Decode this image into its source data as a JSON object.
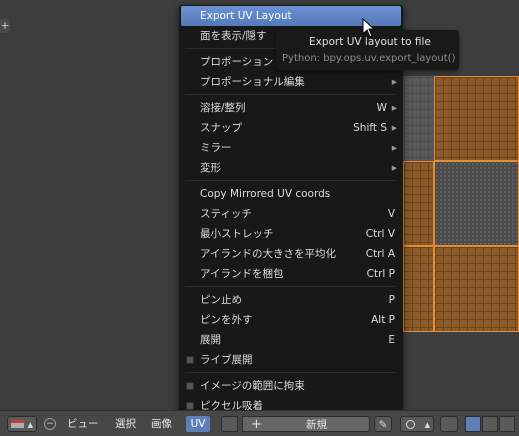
{
  "popup_menu": {
    "items": [
      {
        "label": "Export UV Layout",
        "shortcut": "",
        "submenu": false,
        "checkbox": false,
        "highlighted": true
      },
      {
        "label": "面を表示/隠す",
        "shortcut": "",
        "submenu": false,
        "checkbox": false
      },
      {
        "label": "プロポーション",
        "shortcut": "",
        "submenu": false,
        "checkbox": false
      },
      {
        "label": "プロポーショナル編集",
        "shortcut": "",
        "submenu": true,
        "checkbox": false
      },
      {
        "label": "溶接/整列",
        "shortcut": "W",
        "submenu": true,
        "checkbox": false
      },
      {
        "label": "スナップ",
        "shortcut": "Shift S",
        "submenu": true,
        "checkbox": false
      },
      {
        "label": "ミラー",
        "shortcut": "",
        "submenu": true,
        "checkbox": false
      },
      {
        "label": "変形",
        "shortcut": "",
        "submenu": true,
        "checkbox": false
      },
      {
        "label": "Copy Mirrored UV coords",
        "shortcut": "",
        "submenu": false,
        "checkbox": false
      },
      {
        "label": "スティッチ",
        "shortcut": "V",
        "submenu": false,
        "checkbox": false
      },
      {
        "label": "最小ストレッチ",
        "shortcut": "Ctrl V",
        "submenu": false,
        "checkbox": false
      },
      {
        "label": "アイランドの大きさを平均化",
        "shortcut": "Ctrl A",
        "submenu": false,
        "checkbox": false
      },
      {
        "label": "アイランドを梱包",
        "shortcut": "Ctrl P",
        "submenu": false,
        "checkbox": false
      },
      {
        "label": "ピン止め",
        "shortcut": "P",
        "submenu": false,
        "checkbox": false
      },
      {
        "label": "ピンを外す",
        "shortcut": "Alt P",
        "submenu": false,
        "checkbox": false
      },
      {
        "label": "展開",
        "shortcut": "E",
        "submenu": false,
        "checkbox": false
      },
      {
        "label": "ライブ展開",
        "shortcut": "",
        "submenu": false,
        "checkbox": true
      },
      {
        "label": "イメージの範囲に拘束",
        "shortcut": "",
        "submenu": false,
        "checkbox": true
      },
      {
        "label": "ピクセル吸着",
        "shortcut": "",
        "submenu": false,
        "checkbox": true
      }
    ]
  },
  "tooltip": {
    "title": "Export UV layout to file",
    "python": "Python: bpy.ops.uv.export_layout()"
  },
  "header": {
    "menus": [
      "ビュー",
      "選択",
      "画像",
      "UV"
    ],
    "active_menu": "UV",
    "new_image_label": "新規",
    "add_symbol": "+",
    "pin_symbol": "✎"
  },
  "viewport": {
    "tool_tab_symbol": "+"
  },
  "colors": {
    "highlight": "#5e7fb8",
    "uv_edge": "#e58c3a",
    "menu_bg": "#181818"
  },
  "icons": [
    "editor-type-icon",
    "collapse-icon",
    "image-browse-icon",
    "add-icon",
    "pin-icon",
    "pivot-icon",
    "uv-sync-icon",
    "vertex-select-icon",
    "edge-select-icon",
    "face-select-icon",
    "mouse-pointer-icon",
    "cursor-2d-icon"
  ]
}
